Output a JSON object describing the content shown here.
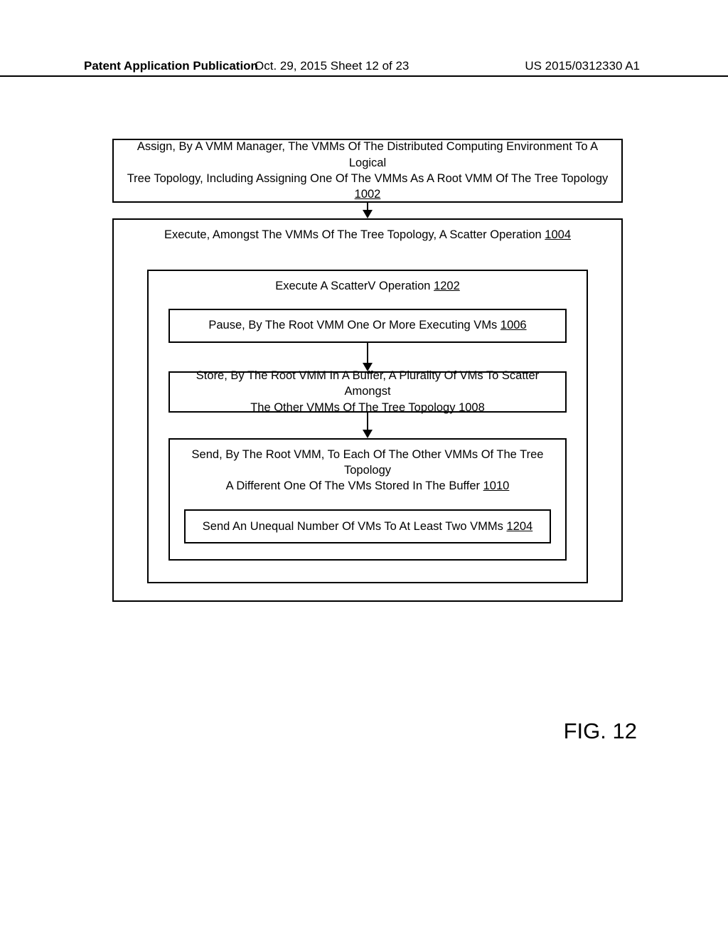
{
  "header": {
    "left": "Patent Application Publication",
    "center": "Oct. 29, 2015  Sheet 12 of 23",
    "right": "US 2015/0312330 A1"
  },
  "boxes": {
    "b1002_line1": "Assign, By A VMM Manager, The VMMs Of The Distributed Computing Environment To A Logical",
    "b1002_line2": "Tree Topology, Including Assigning One Of The VMMs As A Root VMM Of The Tree Topology",
    "b1002_ref": "1002",
    "b1004_title_pre": "Execute, Amongst The VMMs Of The Tree Topology, A Scatter Operation ",
    "b1004_ref": "1004",
    "b1202_title_pre": "Execute A ScatterV Operation ",
    "b1202_ref": "1202",
    "b1006_pre": "Pause, By The Root VMM One Or More Executing VMs ",
    "b1006_ref": "1006",
    "b1008_line1": "Store, By The Root VMM In A Buffer, A Plurality Of VMs To Scatter Amongst",
    "b1008_line2_pre": "The Other VMMs Of The Tree Topology ",
    "b1008_ref": "1008",
    "b1010_line1": "Send, By The Root VMM, To Each Of The Other VMMs Of The Tree Topology",
    "b1010_line2_pre": "A Different One Of The VMs Stored In The Buffer ",
    "b1010_ref": "1010",
    "b1204_pre": "Send An Unequal Number Of VMs To At Least Two VMMs ",
    "b1204_ref": "1204"
  },
  "figure": {
    "label": "FIG. 12"
  }
}
